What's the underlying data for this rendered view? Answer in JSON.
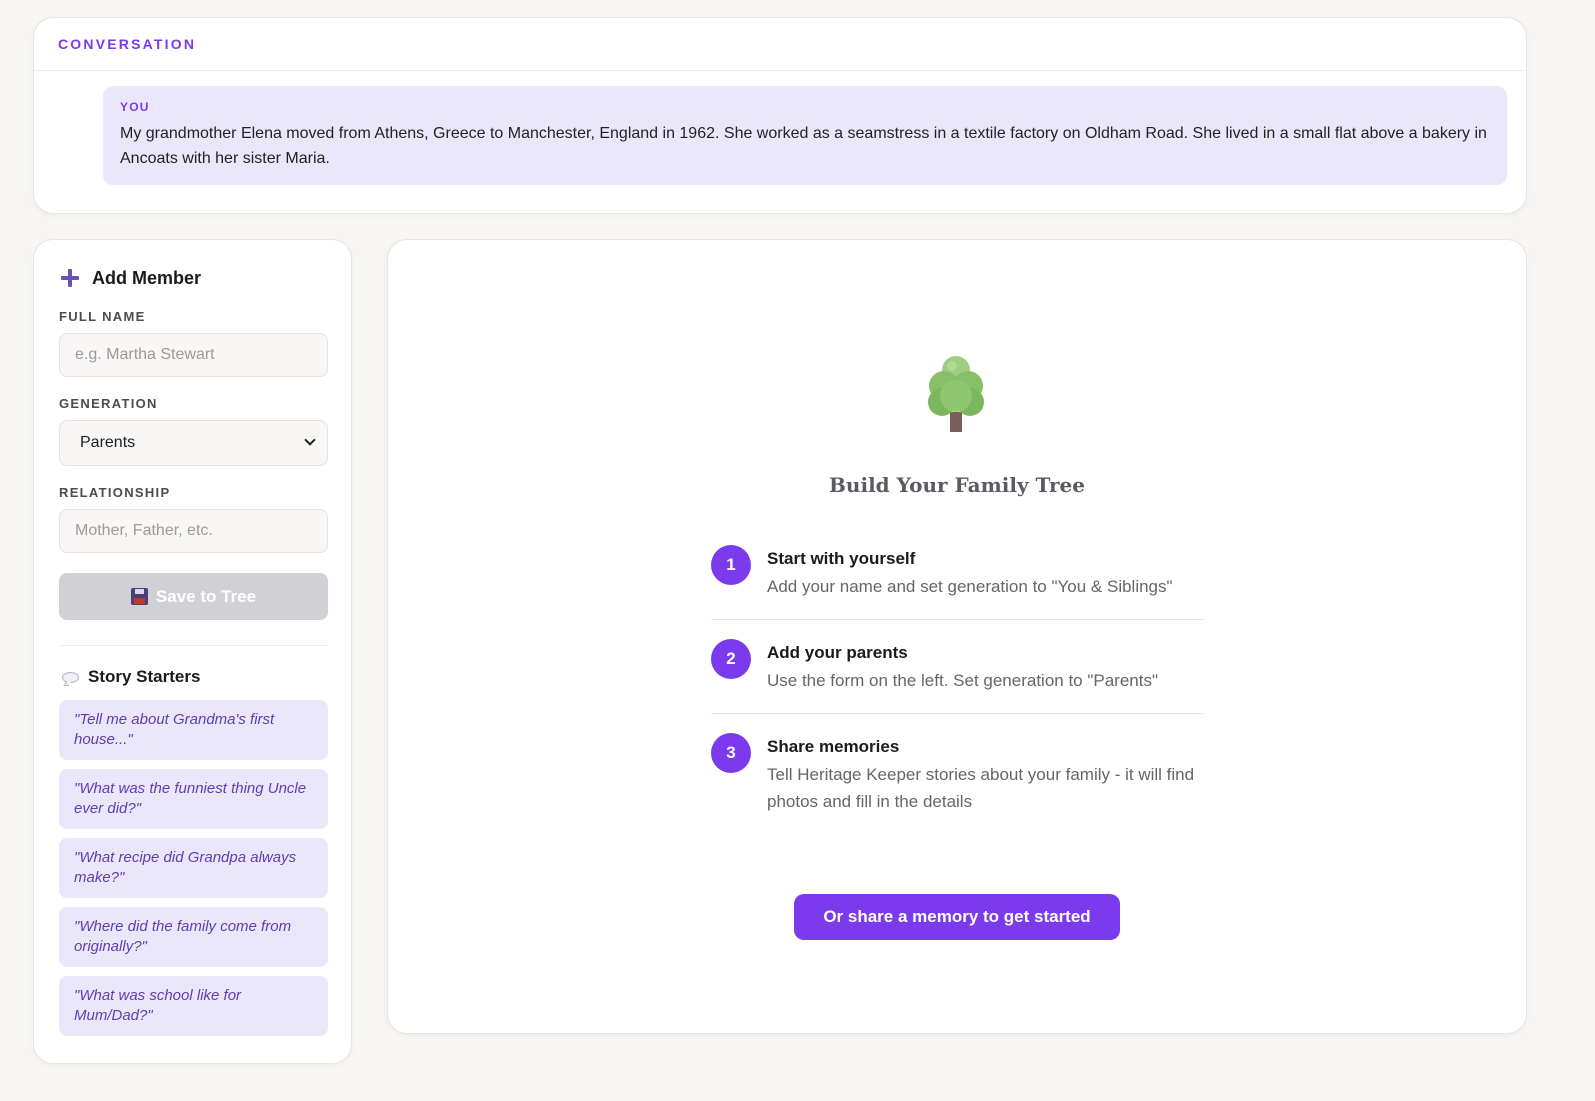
{
  "conversation": {
    "title": "CONVERSATION",
    "messages": [
      {
        "sender": "YOU",
        "text": "My grandmother Elena moved from Athens, Greece to Manchester, England in 1962. She worked as a seamstress in a textile factory on Oldham Road. She lived in a small flat above a bakery in Ancoats with her sister Maria."
      }
    ]
  },
  "sidebar": {
    "title": "Add Member",
    "full_name": {
      "label": "FULL NAME",
      "placeholder": "e.g. Martha Stewart",
      "value": ""
    },
    "generation": {
      "label": "GENERATION",
      "value": "Parents"
    },
    "relationship": {
      "label": "RELATIONSHIP",
      "placeholder": "Mother, Father, etc.",
      "value": ""
    },
    "save_label": "Save to Tree",
    "starters_title": "Story Starters",
    "starters": [
      "\"Tell me about Grandma's first house...\"",
      "\"What was the funniest thing Uncle ever did?\"",
      "\"What recipe did Grandpa always make?\"",
      "\"Where did the family come from originally?\"",
      "\"What was school like for Mum/Dad?\""
    ]
  },
  "main": {
    "icon": "tree-icon",
    "title": "Build Your Family Tree",
    "steps": [
      {
        "number": "1",
        "title": "Start with yourself",
        "desc": "Add your name and set generation to \"You & Siblings\""
      },
      {
        "number": "2",
        "title": "Add your parents",
        "desc": "Use the form on the left. Set generation to \"Parents\""
      },
      {
        "number": "3",
        "title": "Share memories",
        "desc": "Tell Heritage Keeper stories about your family - it will find photos and fill in the details"
      }
    ],
    "cta_label": "Or share a memory to get started"
  },
  "colors": {
    "accent": "#7c3aed",
    "bubble_bg": "#ebe7fb",
    "disabled": "#d1d0d4",
    "page_bg": "#f7f6f3"
  }
}
